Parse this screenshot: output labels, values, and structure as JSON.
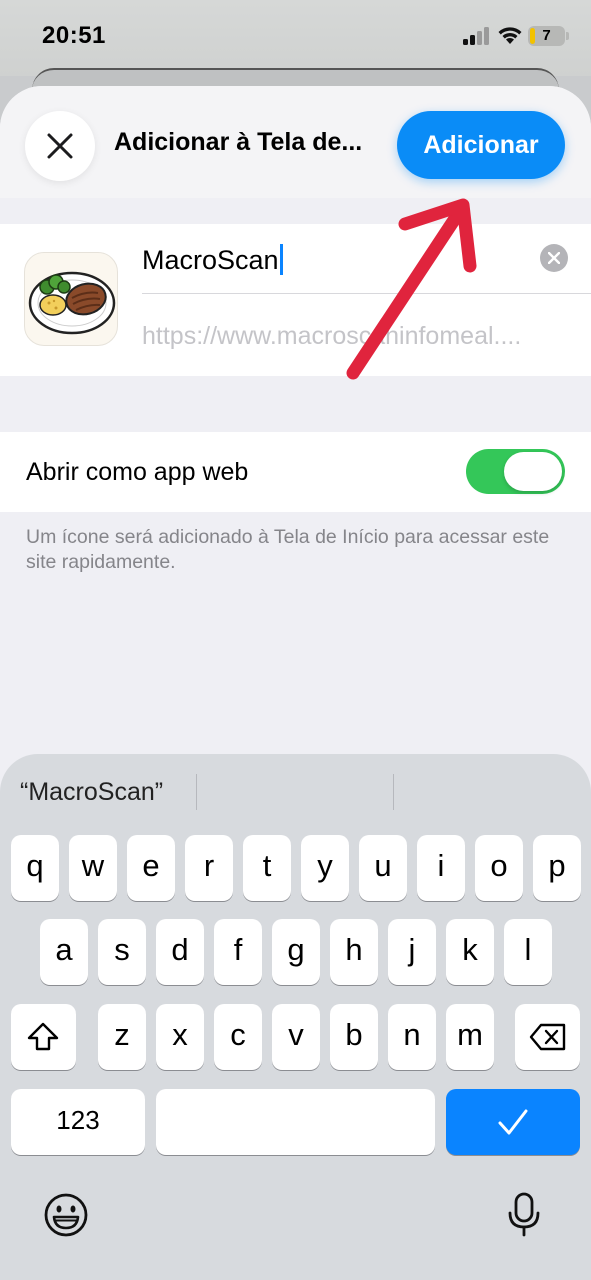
{
  "status_bar": {
    "time": "20:51",
    "battery_level": "7",
    "icons": [
      "cellular-signal-icon",
      "wifi-icon",
      "battery-icon"
    ]
  },
  "sheet": {
    "title": "Adicionar à Tela de...",
    "add_button": "Adicionar",
    "close_icon": "close-icon"
  },
  "app": {
    "name": "MacroScan",
    "url": "https://www.macroscaninfomeal....",
    "icon": "steak-plate-icon"
  },
  "web_app_option": {
    "label": "Abrir como app web",
    "enabled": true
  },
  "footnote": "Um ícone será adicionado à Tela de Início para acessar este site rapidamente.",
  "keyboard": {
    "suggestion": "“MacroScan”",
    "row1": [
      "q",
      "w",
      "e",
      "r",
      "t",
      "y",
      "u",
      "i",
      "o",
      "p"
    ],
    "row2": [
      "a",
      "s",
      "d",
      "f",
      "g",
      "h",
      "j",
      "k",
      "l"
    ],
    "row3": [
      "z",
      "x",
      "c",
      "v",
      "b",
      "n",
      "m"
    ],
    "numbers_key": "123",
    "colors": {
      "done": "#0a84ff",
      "toggle": "#34c759",
      "add_button": "#0a8cf7",
      "arrow": "#e0243d"
    }
  }
}
